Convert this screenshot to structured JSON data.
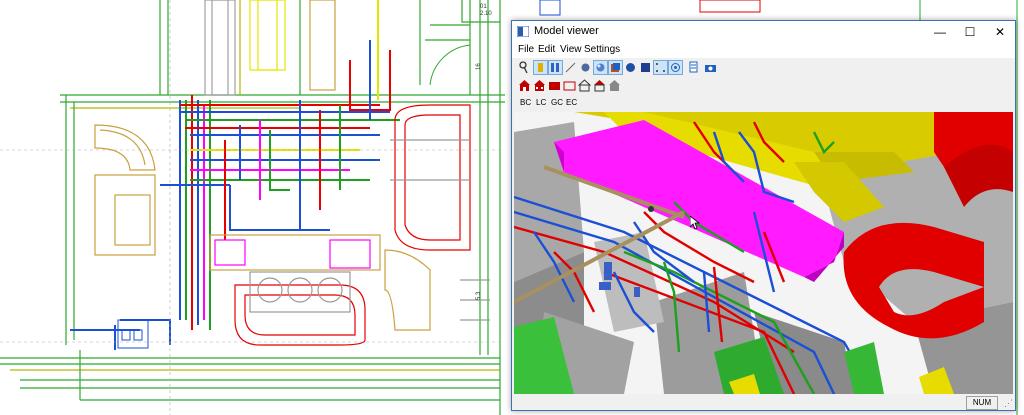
{
  "cad": {
    "room_label_1": "01",
    "room_label_2": "2.10",
    "room_label_3": "16",
    "room_label_4": "5.3"
  },
  "window": {
    "title": "Model viewer",
    "controls": {
      "minimize": "—",
      "maximize": "☐",
      "close": "✕"
    }
  },
  "menu": [
    "File",
    "Edit",
    "View",
    "Settings"
  ],
  "toolbar": {
    "labels": [
      "BC",
      "LC",
      "GC",
      "EC"
    ]
  },
  "status": {
    "num": "NUM"
  },
  "colors": {
    "supply_duct": "#ff00ff",
    "return_duct": "#e6e600",
    "exhaust_duct": "#e60000",
    "pipe_blue": "#1a4fd6",
    "pipe_green": "#1ea01e",
    "structure_gray": "#9a9a9a"
  }
}
